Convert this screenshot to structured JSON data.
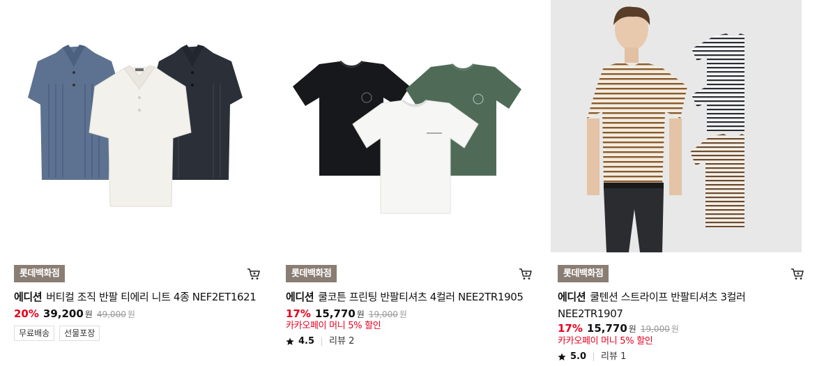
{
  "products": [
    {
      "store": "롯데백화점",
      "brand": "에디션",
      "name": "버티컬 조직 반팔 티에리 니트 4종 NEF2ET1621",
      "discount": "20%",
      "price": "39,200",
      "currency": "원",
      "original_price": "49,000",
      "tags": [
        "무료배송",
        "선물포장"
      ]
    },
    {
      "store": "롯데백화점",
      "brand": "에디션",
      "name": "쿨코튼 프린팅 반팔티셔츠 4컬러 NEE2TR1905",
      "discount": "17%",
      "price": "15,770",
      "currency": "원",
      "original_price": "19,000",
      "promo": "카카오페이 머니 5% 할인",
      "rating": "4.5",
      "review_label": "리뷰 2"
    },
    {
      "store": "롯데백화점",
      "brand": "에디션",
      "name": "쿨텐션 스트라이프 반팔티셔츠 3컬러 NEE2TR1907",
      "discount": "17%",
      "price": "15,770",
      "currency": "원",
      "original_price": "19,000",
      "promo": "카카오페이 머니 5% 할인",
      "rating": "5.0",
      "review_label": "리뷰 1"
    }
  ],
  "colors": {
    "store_badge": "#8a7e74",
    "discount": "#e6001e",
    "promo": "#e6001e"
  },
  "icons": {
    "cart": "cart-icon",
    "star": "star-icon"
  }
}
